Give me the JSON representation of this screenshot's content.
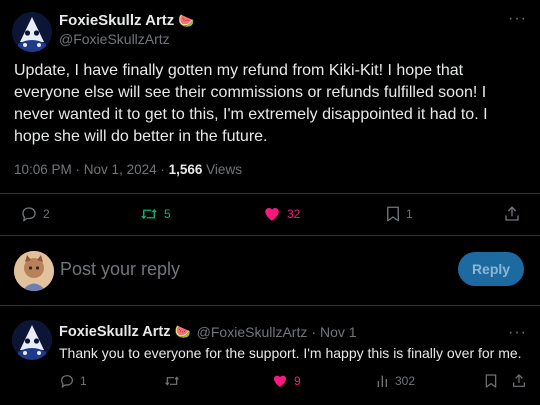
{
  "tweet": {
    "author_name": "FoxieSkullz Artz",
    "author_emoji": "🍉",
    "author_handle": "@FoxieSkullzArtz",
    "text": "Update, I have finally gotten my refund from Kiki-Kit! I hope that everyone else will see their commissions or refunds fulfilled soon! I never wanted it to get to this, I'm extremely disappointed it had to. I hope she will do better in the future.",
    "time": "10:06 PM",
    "date": "Nov 1, 2024",
    "views_count": "1,566",
    "views_label": "Views",
    "actions": {
      "replies": "2",
      "reposts": "5",
      "likes": "32",
      "bookmarks": "1"
    }
  },
  "reply_box": {
    "placeholder": "Post your reply",
    "button_label": "Reply"
  },
  "reply": {
    "author_name": "FoxieSkullz Artz",
    "author_emoji": "🍉",
    "author_handle": "@FoxieSkullzArtz",
    "date": "Nov 1",
    "text": "Thank you to everyone for the support. I'm happy this is finally over for me.",
    "actions": {
      "replies": "1",
      "likes": "9",
      "views": "302"
    }
  },
  "colors": {
    "like": "#f91880",
    "repost": "#00ba7c",
    "muted": "#71767b",
    "accent": "#1d9bf0"
  }
}
